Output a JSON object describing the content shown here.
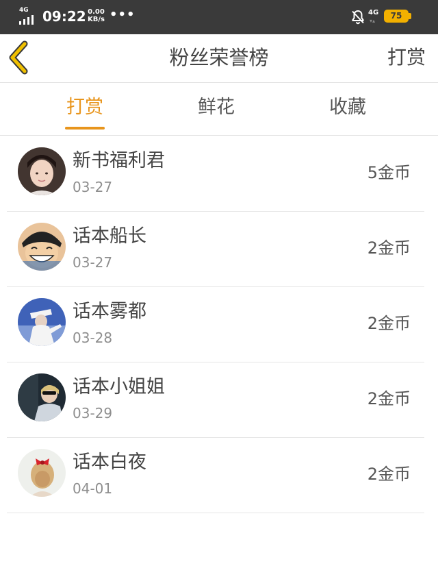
{
  "status_bar": {
    "network_left": "4G",
    "time": "09:22",
    "speed_value": "0.00",
    "speed_unit": "KB/s",
    "more_dots": "•••",
    "network_right": "4G",
    "battery_level": "75",
    "battery_color": "#f2b000",
    "icons": [
      "signal-icon",
      "bell-off-icon",
      "battery-icon"
    ]
  },
  "header": {
    "back_icon": "chevron-left-icon",
    "title": "粉丝荣誉榜",
    "action_label": "打赏",
    "accent_color": "#f0c000"
  },
  "tabs": [
    {
      "label": "打赏",
      "active": true
    },
    {
      "label": "鲜花",
      "active": false
    },
    {
      "label": "收藏",
      "active": false
    }
  ],
  "active_color": "#e8951c",
  "list": [
    {
      "name": "新书福利君",
      "date": "03-27",
      "amount": "5金币",
      "avatar": "avatar-girl"
    },
    {
      "name": "话本船长",
      "date": "03-27",
      "amount": "2金币",
      "avatar": "avatar-cartoon"
    },
    {
      "name": "话本雾都",
      "date": "03-28",
      "amount": "2金币",
      "avatar": "avatar-hat"
    },
    {
      "name": "话本小姐姐",
      "date": "03-29",
      "amount": "2金币",
      "avatar": "avatar-car"
    },
    {
      "name": "话本白夜",
      "date": "04-01",
      "amount": "2金币",
      "avatar": "avatar-bow"
    }
  ]
}
